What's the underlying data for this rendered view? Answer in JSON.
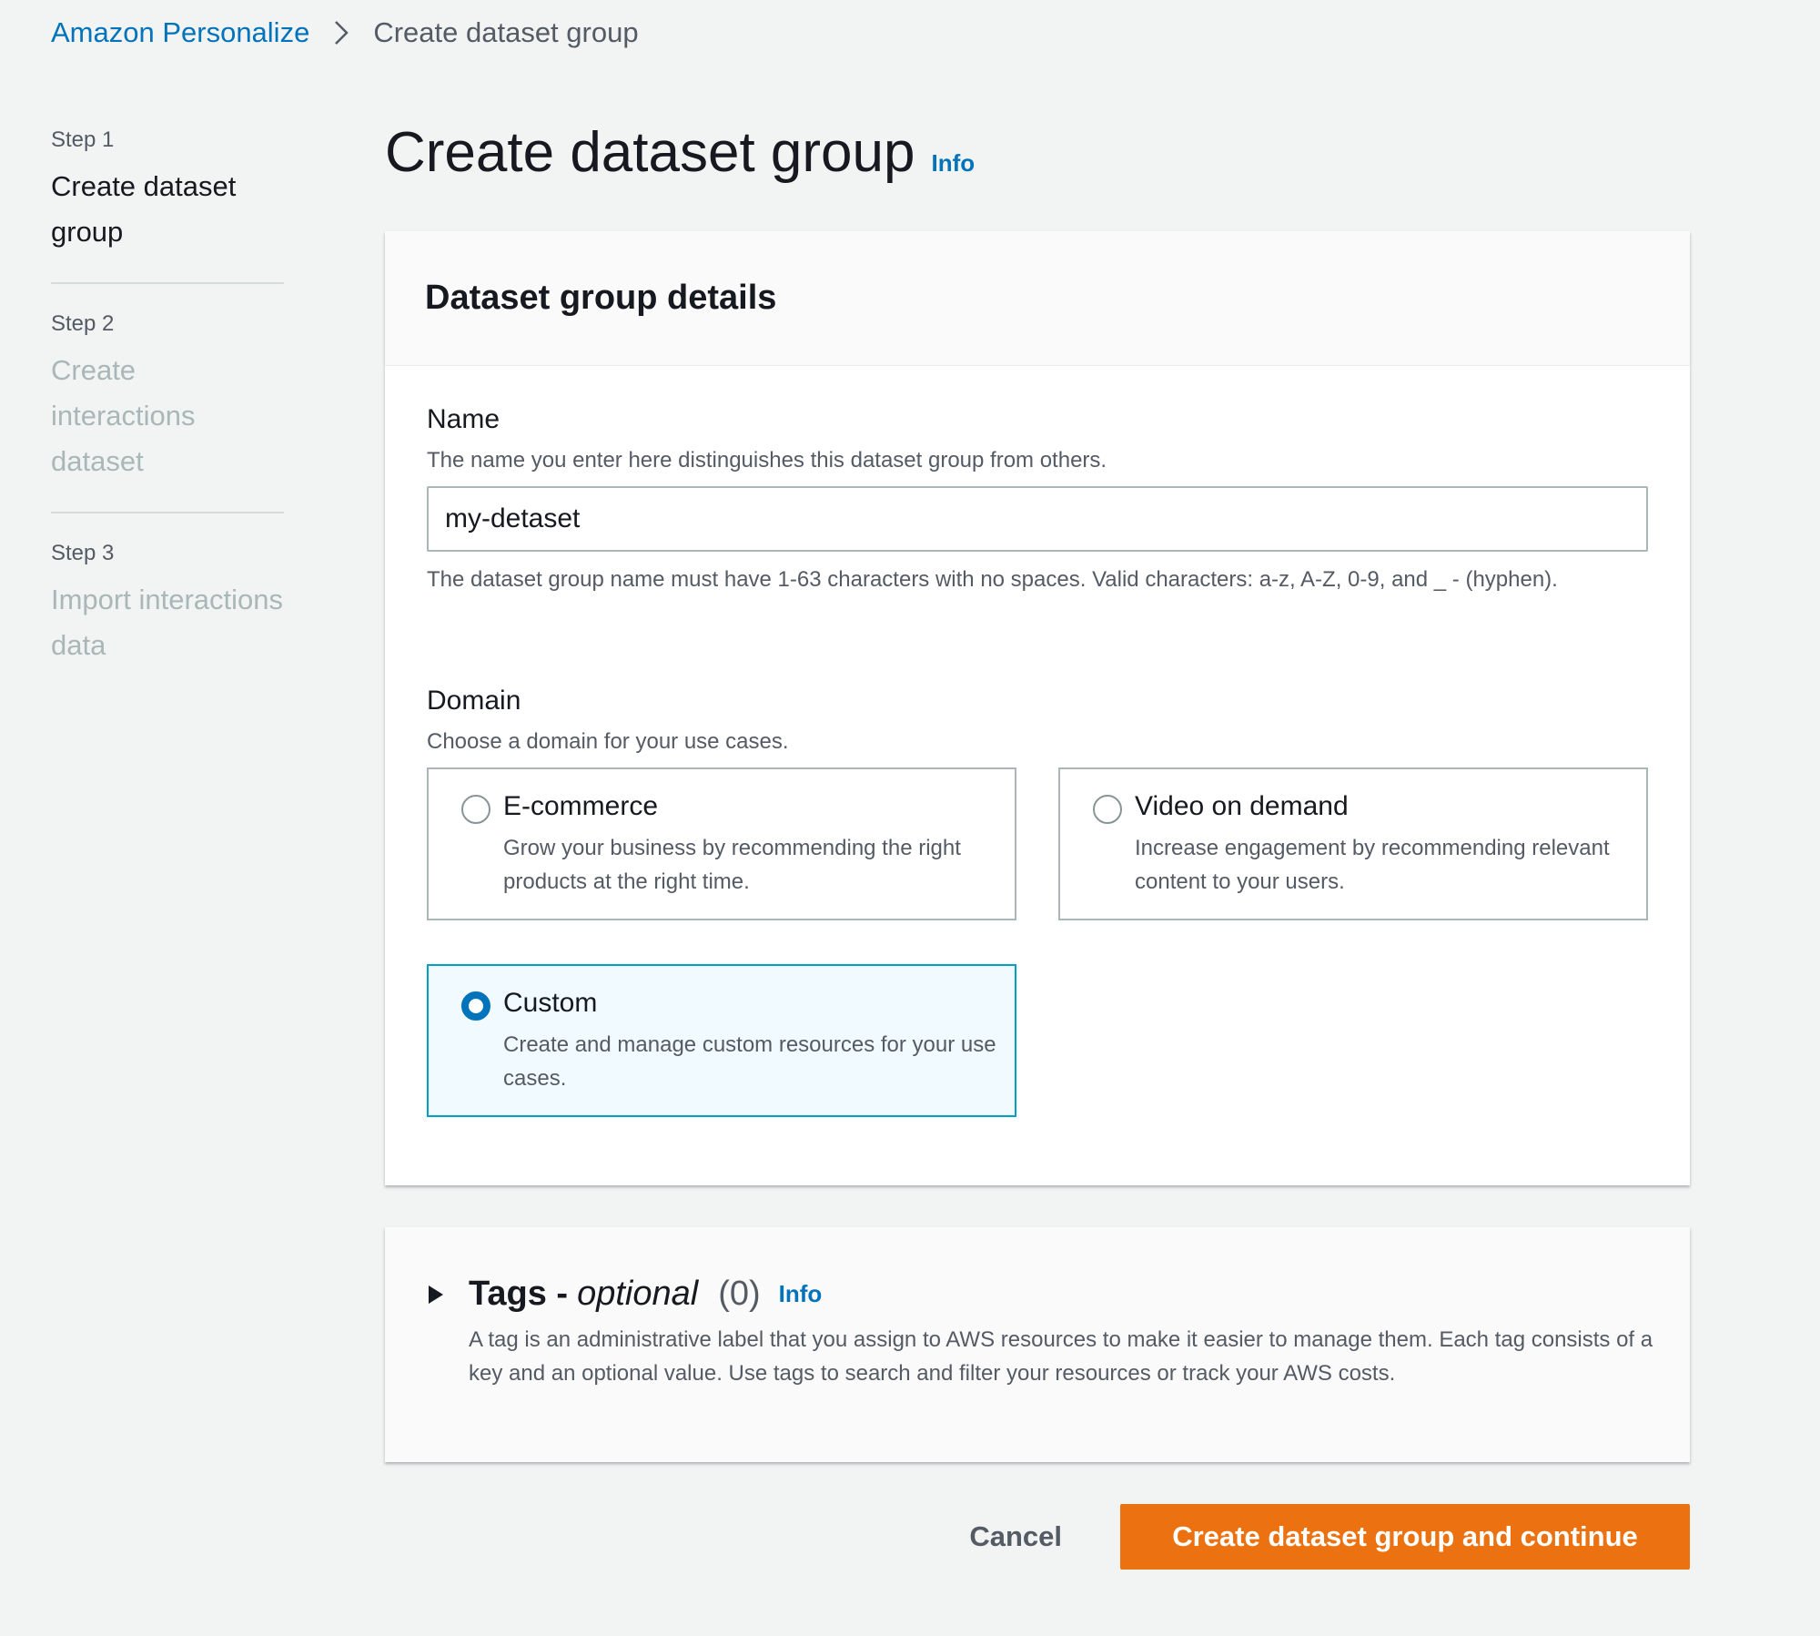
{
  "colors": {
    "background": "#f2f3f3",
    "link": "#0073bb",
    "primary_button": "#ec7211",
    "selected_tile_border": "#00a1c9",
    "selected_tile_bg": "#f1faff"
  },
  "breadcrumb": {
    "parent": "Amazon Personalize",
    "separator_icon": "chevron-right-icon",
    "current": "Create dataset group"
  },
  "steps": [
    {
      "number": "Step 1",
      "title": "Create dataset group",
      "state": "active"
    },
    {
      "number": "Step 2",
      "title": "Create interactions dataset",
      "state": "disabled"
    },
    {
      "number": "Step 3",
      "title": "Import interactions data",
      "state": "disabled"
    }
  ],
  "page": {
    "title": "Create dataset group",
    "info": "Info"
  },
  "details": {
    "header": "Dataset group details",
    "name": {
      "label": "Name",
      "description": "The name you enter here distinguishes this dataset group from others.",
      "value": "my-detaset",
      "constraint": "The dataset group name must have 1-63 characters with no spaces. Valid characters: a-z, A-Z, 0-9, and _ - (hyphen)."
    },
    "domain": {
      "label": "Domain",
      "description": "Choose a domain for your use cases.",
      "selected": "Custom",
      "options": [
        {
          "title": "E-commerce",
          "description": "Grow your business by recommending the right products at the right time."
        },
        {
          "title": "Video on demand",
          "description": "Increase engagement by recommending relevant content to your users."
        },
        {
          "title": "Custom",
          "description": "Create and manage custom resources for your use cases."
        }
      ]
    }
  },
  "tags": {
    "toggle_icon": "caret-right-icon",
    "title": "Tags -",
    "optional": "optional",
    "count": "(0)",
    "info": "Info",
    "description": "A tag is an administrative label that you assign to AWS resources to make it easier to manage them. Each tag consists of a key and an optional value. Use tags to search and filter your resources or track your AWS costs."
  },
  "actions": {
    "cancel": "Cancel",
    "submit": "Create dataset group and continue"
  }
}
